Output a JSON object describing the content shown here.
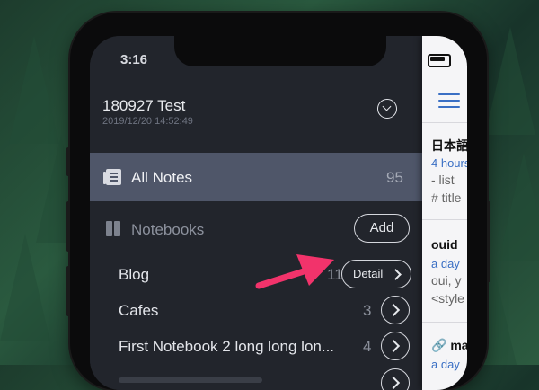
{
  "status_bar": {
    "time": "3:16"
  },
  "sidebar": {
    "database_title": "180927 Test",
    "database_date": "2019/12/20 14:52:49",
    "all_notes": {
      "label": "All Notes",
      "count": "95"
    },
    "notebooks": {
      "label": "Notebooks",
      "add_label": "Add",
      "items": [
        {
          "label": "Blog",
          "count": "11",
          "action": "Detail"
        },
        {
          "label": "Cafes",
          "count": "3"
        },
        {
          "label": "First Notebook 2 long long lon...",
          "count": "4"
        }
      ]
    }
  },
  "note_list": {
    "items": [
      {
        "title": "日本語",
        "time": "4 hours",
        "lines": [
          "- list",
          "# title"
        ]
      },
      {
        "title": "ouid",
        "time": "a day",
        "lines": [
          "oui, y",
          "<style"
        ]
      },
      {
        "title": "🔗 ma",
        "time": "a day",
        "lines": []
      }
    ]
  },
  "colors": {
    "selected_row": "#4f5669",
    "sidebar_bg": "#22252c",
    "accent_blue": "#3a6fc4",
    "arrow": "#f2336b"
  }
}
